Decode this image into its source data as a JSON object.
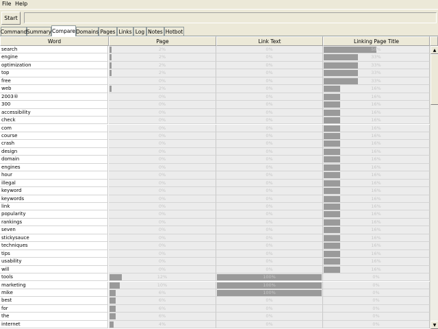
{
  "menu": [
    "File",
    "Help"
  ],
  "toolbar": {
    "start_label": "Start",
    "url_value": ""
  },
  "tabs": [
    "Command",
    "Summary",
    "Compare",
    "Domains",
    "Pages",
    "Links",
    "Log",
    "Notes",
    "Hotbot"
  ],
  "active_tab": "Compare",
  "columns": [
    "Word",
    "Page",
    "Link Text",
    "Linking Page Title"
  ],
  "rows": [
    {
      "word": "search",
      "page": "2%",
      "link_text": "0%",
      "title": "50%"
    },
    {
      "word": "engine",
      "page": "2%",
      "link_text": "0%",
      "title": "33%"
    },
    {
      "word": "optimization",
      "page": "2%",
      "link_text": "0%",
      "title": "33%"
    },
    {
      "word": "top",
      "page": "2%",
      "link_text": "0%",
      "title": "33%"
    },
    {
      "word": "free",
      "page": "0%",
      "link_text": "0%",
      "title": "33%"
    },
    {
      "word": "web",
      "page": "2%",
      "link_text": "0%",
      "title": "16%"
    },
    {
      "word": "2003®",
      "page": "0%",
      "link_text": "0%",
      "title": "16%"
    },
    {
      "word": "300",
      "page": "0%",
      "link_text": "0%",
      "title": "16%"
    },
    {
      "word": "accessibility",
      "page": "0%",
      "link_text": "0%",
      "title": "16%"
    },
    {
      "word": "check",
      "page": "0%",
      "link_text": "0%",
      "title": "16%"
    },
    {
      "word": "com",
      "page": "0%",
      "link_text": "0%",
      "title": "16%"
    },
    {
      "word": "course",
      "page": "0%",
      "link_text": "0%",
      "title": "16%"
    },
    {
      "word": "crash",
      "page": "0%",
      "link_text": "0%",
      "title": "16%"
    },
    {
      "word": "design",
      "page": "0%",
      "link_text": "0%",
      "title": "16%"
    },
    {
      "word": "domain",
      "page": "0%",
      "link_text": "0%",
      "title": "16%"
    },
    {
      "word": "engines",
      "page": "0%",
      "link_text": "0%",
      "title": "16%"
    },
    {
      "word": "hour",
      "page": "0%",
      "link_text": "0%",
      "title": "16%"
    },
    {
      "word": "illegal",
      "page": "0%",
      "link_text": "0%",
      "title": "16%"
    },
    {
      "word": "keyword",
      "page": "0%",
      "link_text": "0%",
      "title": "16%"
    },
    {
      "word": "keywords",
      "page": "0%",
      "link_text": "0%",
      "title": "16%"
    },
    {
      "word": "link",
      "page": "0%",
      "link_text": "0%",
      "title": "16%"
    },
    {
      "word": "popularity",
      "page": "0%",
      "link_text": "0%",
      "title": "16%"
    },
    {
      "word": "rankings",
      "page": "0%",
      "link_text": "0%",
      "title": "16%"
    },
    {
      "word": "seven",
      "page": "0%",
      "link_text": "0%",
      "title": "16%"
    },
    {
      "word": "stickysauce",
      "page": "0%",
      "link_text": "0%",
      "title": "16%"
    },
    {
      "word": "techniques",
      "page": "0%",
      "link_text": "0%",
      "title": "16%"
    },
    {
      "word": "tips",
      "page": "0%",
      "link_text": "0%",
      "title": "16%"
    },
    {
      "word": "usability",
      "page": "0%",
      "link_text": "0%",
      "title": "16%"
    },
    {
      "word": "will",
      "page": "0%",
      "link_text": "0%",
      "title": "16%"
    },
    {
      "word": "tools",
      "page": "12%",
      "link_text": "100%",
      "title": "0%"
    },
    {
      "word": "marketing",
      "page": "10%",
      "link_text": "100%",
      "title": "0%"
    },
    {
      "word": "mike",
      "page": "6%",
      "link_text": "100%",
      "title": "0%"
    },
    {
      "word": "best",
      "page": "6%",
      "link_text": "0%",
      "title": "0%"
    },
    {
      "word": "for",
      "page": "6%",
      "link_text": "0%",
      "title": "0%"
    },
    {
      "word": "the",
      "page": "6%",
      "link_text": "0%",
      "title": "0%"
    },
    {
      "word": "internet",
      "page": "4%",
      "link_text": "0%",
      "title": "0%"
    }
  ],
  "colors": {
    "bar": "#9a9a9a",
    "bar_bg": "#ececec",
    "window_bg": "#ece9d8"
  },
  "icons": {
    "scroll_up": "▲",
    "scroll_down": "▼"
  }
}
